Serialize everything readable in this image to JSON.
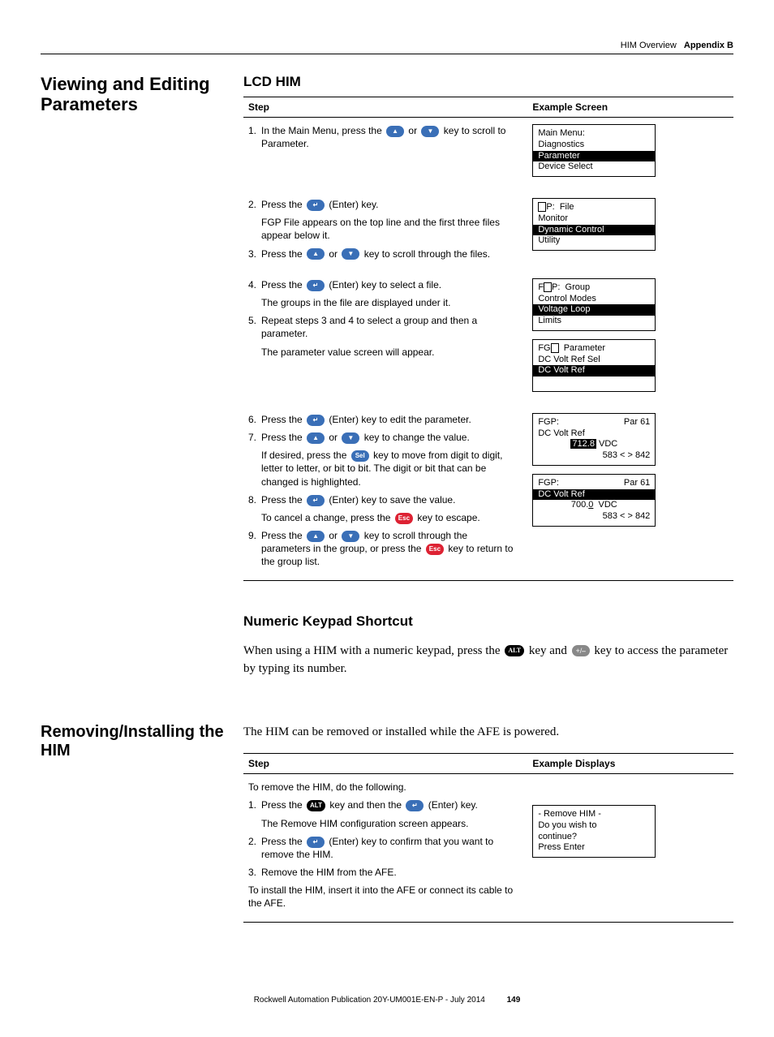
{
  "header": {
    "chapter": "HIM Overview",
    "appendix": "Appendix B"
  },
  "section1": {
    "title": "Viewing and Editing Parameters",
    "sub": "LCD HIM",
    "th_step": "Step",
    "th_screen": "Example Screen",
    "rows": [
      {
        "steps": [
          {
            "n": "1.",
            "pre": "In the Main Menu, press the ",
            "k1": "up",
            "mid": " or ",
            "k2": "down",
            "post": " key to scroll to Parameter."
          }
        ],
        "lcd": {
          "lines": [
            {
              "t": "Main Menu:",
              "inv": false
            },
            {
              "t": "Diagnostics",
              "inv": false
            },
            {
              "t": "Parameter",
              "inv": true
            },
            {
              "t": "Device Select",
              "inv": false
            }
          ]
        }
      },
      {
        "steps": [
          {
            "n": "2.",
            "pre": "Press the ",
            "k1": "enter",
            "post": " (Enter) key."
          },
          {
            "indent": true,
            "t": "FGP File appears on the top line and the first three files appear below it."
          },
          {
            "n": "3.",
            "pre": "Press the ",
            "k1": "up",
            "mid": " or ",
            "k2": "down",
            "post": " key to scroll through the files."
          }
        ],
        "lcd": {
          "lines": [
            {
              "cursor_prefix": true,
              "t": "P:  File",
              "inv": false,
              "label": "FGP:  File"
            },
            {
              "t": "Monitor",
              "inv": false
            },
            {
              "t": "Dynamic Control",
              "inv": true
            },
            {
              "t": "Utility",
              "inv": false
            }
          ]
        }
      },
      {
        "steps": [
          {
            "n": "4.",
            "pre": "Press the ",
            "k1": "enter",
            "post": " (Enter) key to select a file."
          },
          {
            "indent": true,
            "t": "The groups in the file are displayed under it."
          },
          {
            "n": "5.",
            "t": "Repeat steps 3 and 4 to select a group and then a parameter."
          },
          {
            "indent": true,
            "t": "The parameter value screen will appear."
          }
        ],
        "lcd_multi": [
          {
            "lines": [
              {
                "cursor_mid": true,
                "pre": "F",
                "post": "P:  Group"
              },
              {
                "t": "Control Modes",
                "inv": false
              },
              {
                "t": "Voltage Loop",
                "inv": true
              },
              {
                "t": "Limits",
                "inv": false
              }
            ]
          },
          {
            "lines": [
              {
                "t_split": [
                  "FG",
                  "  Parameter"
                ],
                "cursor_after_first": true
              },
              {
                "t": "DC Volt Ref Sel",
                "inv": false
              },
              {
                "t": "DC Volt Ref",
                "inv": true
              },
              {
                "t": " ",
                "inv": false
              }
            ]
          }
        ]
      },
      {
        "steps": [
          {
            "n": "6.",
            "pre": "Press the ",
            "k1": "enter",
            "post": " (Enter) key to edit the parameter."
          },
          {
            "n": "7.",
            "pre": "Press the ",
            "k1": "up",
            "mid": " or ",
            "k2": "down",
            "post": " key to change the value."
          },
          {
            "indent": true,
            "pre": "If desired, press the ",
            "k1": "sel",
            "post": " key to move from digit to digit, letter to letter, or bit to bit. The digit or bit that can be changed is highlighted."
          },
          {
            "n": "8.",
            "pre": "Press the ",
            "k1": "enter",
            "post": " (Enter) key to save the value."
          },
          {
            "indent": true,
            "pre": "To cancel a change, press the ",
            "k1": "esc",
            "post": " key to escape."
          },
          {
            "n": "9.",
            "pre": "Press the ",
            "k1": "up",
            "mid": " or ",
            "k2": "down",
            "post": " key to scroll through the parameters in the group, or press the ",
            "k3": "esc",
            "post2": " key to return to the group list."
          }
        ],
        "lcd_multi": [
          {
            "lines": [
              {
                "split": [
                  "FGP:",
                  "Par 61"
                ]
              },
              {
                "t": "DC Volt Ref",
                "inv": false
              },
              {
                "center": true,
                "hl": "712.8",
                "after": " VDC"
              },
              {
                "right": true,
                "t": "583 < > 842"
              }
            ]
          },
          {
            "lines": [
              {
                "split": [
                  "FGP:",
                  "Par 61"
                ]
              },
              {
                "t": "DC Volt Ref",
                "inv": true
              },
              {
                "center": true,
                "underline_digit": "0",
                "pre_text": "700.",
                "after": "  VDC"
              },
              {
                "right": true,
                "t": "583 < > 842"
              }
            ]
          }
        ]
      }
    ]
  },
  "shortcut": {
    "title": "Numeric Keypad Shortcut",
    "para_pre": "When using a HIM with a numeric keypad, press the ",
    "k1": "alt",
    "mid": " key and ",
    "k2": "pm",
    "para_post": " key to access the parameter by typing its number."
  },
  "section2": {
    "title": "Removing/Installing the HIM",
    "intro": "The HIM can be removed or installed while the AFE is powered.",
    "th_step": "Step",
    "th_disp": "Example Displays",
    "steps_intro": "To remove the HIM, do the following.",
    "steps": [
      {
        "n": "1.",
        "pre": "Press the ",
        "k1": "alt",
        "mid": " key and then the ",
        "k2": "enter",
        "post": " (Enter) key."
      },
      {
        "indent": true,
        "t": "The Remove HIM configuration screen appears."
      },
      {
        "n": "2.",
        "pre": "Press the ",
        "k1": "enter",
        "post": " (Enter) key to confirm that you want to remove the HIM."
      },
      {
        "n": "3.",
        "t": "Remove the HIM from the AFE."
      }
    ],
    "steps_outro": "To install the HIM, insert it into the AFE or connect its cable to the AFE.",
    "lcd": {
      "lines": [
        {
          "t": "- Remove HIM -"
        },
        {
          "t": "Do you wish to"
        },
        {
          "t": "continue?"
        },
        {
          "t": "Press Enter"
        }
      ]
    }
  },
  "footer": {
    "pub": "Rockwell Automation Publication 20Y-UM001E-EN-P - July 2014",
    "page": "149"
  },
  "key_glyphs": {
    "up": "▲",
    "down": "▼",
    "enter": "↵",
    "sel": "Sel",
    "esc": "Esc",
    "alt": "ALT",
    "pm": "+/–"
  }
}
